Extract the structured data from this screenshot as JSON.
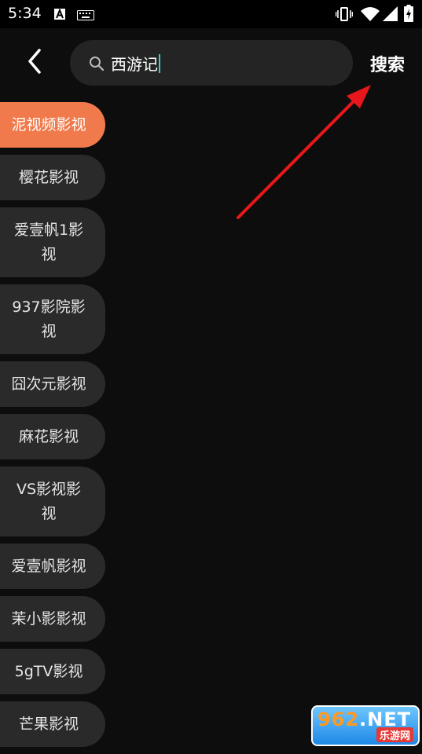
{
  "status_bar": {
    "time": "5:34",
    "icons": [
      "text-a-icon",
      "keyboard-icon",
      "vibrate-icon",
      "wifi-icon",
      "signal-icon",
      "battery-charging-icon"
    ]
  },
  "search": {
    "value": "西游记",
    "submit_label": "搜索"
  },
  "categories": [
    {
      "label": "泥视频影视",
      "active": true
    },
    {
      "label": "樱花影视"
    },
    {
      "label": "爱壹帆1影视"
    },
    {
      "label": "937影院影视"
    },
    {
      "label": "囧次元影视"
    },
    {
      "label": "麻花影视"
    },
    {
      "label": "VS影视影视"
    },
    {
      "label": "爱壹帆影视"
    },
    {
      "label": "茉小影影视"
    },
    {
      "label": "5gTV影视"
    },
    {
      "label": "芒果影视"
    }
  ],
  "colors": {
    "accent": "#f07a4c",
    "annotation_arrow": "#e8171b",
    "caret": "#2fd4c8"
  },
  "watermark": {
    "brand_number": "962",
    "brand_suffix": ".NET",
    "brand_text": "乐游网"
  }
}
